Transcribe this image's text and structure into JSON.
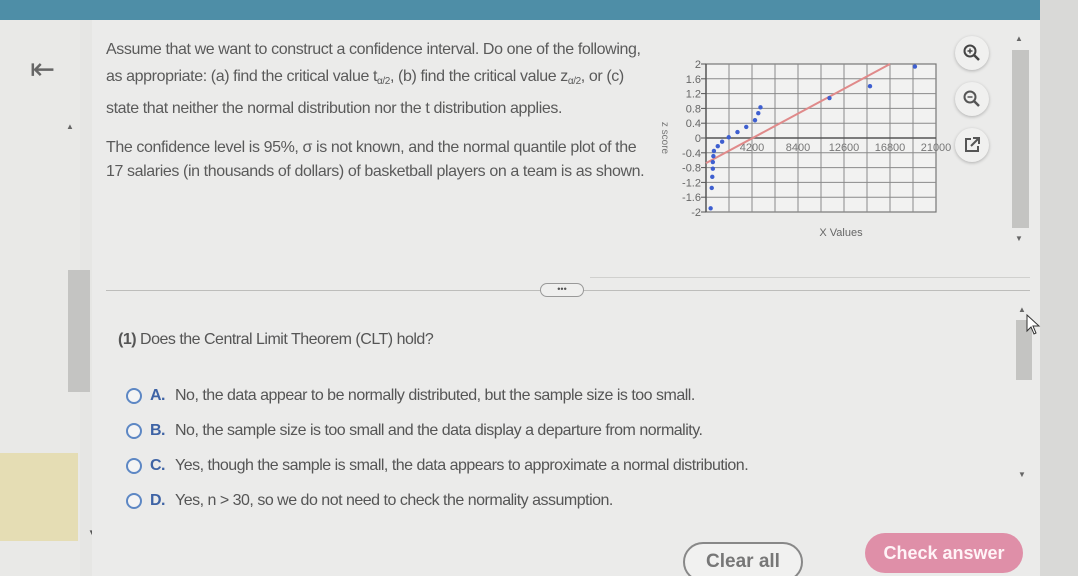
{
  "window": {
    "accent_color": "#4e8ea7"
  },
  "nav": {
    "collapse_icon": "collapse-left-arrow-icon"
  },
  "question": {
    "para1_part1": "Assume that we want to construct a confidence interval. Do one of the following, as appropriate: (a) find the critical value t",
    "t_subscript": "α/2",
    "para1_part2": ", (b) find the critical value z",
    "z_subscript": "α/2",
    "para1_part3": ", or (c) state that neither the normal distribution nor the t distribution applies.",
    "para2": "The confidence level is 95%, σ is not known, and the normal quantile plot of the 17 salaries (in thousands of dollars) of basketball players on a team is as shown."
  },
  "tools": {
    "zoom_in": "zoom-in-icon",
    "zoom_out": "zoom-out-icon",
    "popout": "popout-icon"
  },
  "more_button_label": "•••",
  "part1": {
    "number": "(1)",
    "prompt": "Does the Central Limit Theorem (CLT) hold?",
    "options": [
      {
        "letter": "A.",
        "text": "No, the data appear to be normally distributed, but the sample size is too small."
      },
      {
        "letter": "B.",
        "text": "No, the sample size is too small and the data display a departure from normality."
      },
      {
        "letter": "C.",
        "text": "Yes, though the sample is small, the data appears to approximate a normal distribution."
      },
      {
        "letter": "D.",
        "text": "Yes, n > 30, so we do not need to check the normality assumption."
      }
    ]
  },
  "buttons": {
    "clear_all": "Clear all",
    "check_answer": "Check answer",
    "check_color": "#df8fa8"
  },
  "chart_data": {
    "type": "scatter",
    "title": "",
    "xlabel": "X Values",
    "ylabel": "z score",
    "xlim": [
      0,
      21000
    ],
    "ylim": [
      -2,
      2
    ],
    "x_ticks": [
      "4200",
      "8400",
      "12600",
      "16800",
      "21000"
    ],
    "y_ticks": [
      "2",
      "1.6",
      "1.2",
      "0.8",
      "0.4",
      "0",
      "-0.4",
      "-0.8",
      "-1.2",
      "-1.6",
      "-2"
    ],
    "grid": true,
    "points": [
      {
        "x": 150,
        "z": -1.9
      },
      {
        "x": 250,
        "z": -1.35
      },
      {
        "x": 300,
        "z": -1.05
      },
      {
        "x": 350,
        "z": -0.83
      },
      {
        "x": 350,
        "z": -0.65
      },
      {
        "x": 400,
        "z": -0.49
      },
      {
        "x": 450,
        "z": -0.35
      },
      {
        "x": 800,
        "z": -0.22
      },
      {
        "x": 1200,
        "z": -0.1
      },
      {
        "x": 1800,
        "z": 0.02
      },
      {
        "x": 2600,
        "z": 0.16
      },
      {
        "x": 3400,
        "z": 0.3
      },
      {
        "x": 4200,
        "z": 0.48
      },
      {
        "x": 4500,
        "z": 0.67
      },
      {
        "x": 4700,
        "z": 0.83
      },
      {
        "x": 11000,
        "z": 1.08
      },
      {
        "x": 14700,
        "z": 1.4
      },
      {
        "x": 18800,
        "z": 1.93
      }
    ],
    "reference_line": {
      "x0": 0,
      "z0": -0.68,
      "x1": 16800,
      "z1": 2.0,
      "color": "#e08a8a"
    },
    "point_color": "#3e5fd0"
  }
}
